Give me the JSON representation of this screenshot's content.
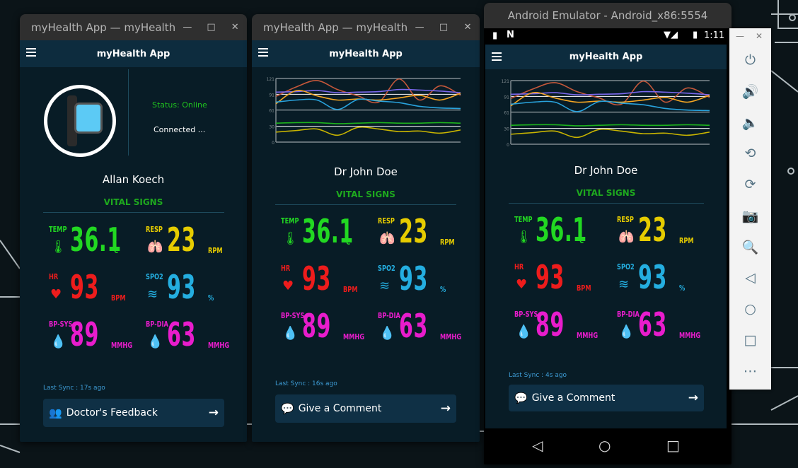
{
  "windows": [
    {
      "title": "myHealth App — myHealth",
      "app_title": "myHealth App",
      "patient_name": "Allan Koech",
      "status": "Status: Online",
      "connection": "Connected ...",
      "section_title": "VITAL SIGNS",
      "last_sync": "Last Sync : 17s ago",
      "button_label": "Doctor's Feedback",
      "button_icon": "users-icon",
      "vitals": [
        {
          "label": "TEMP",
          "value": "36.1",
          "unit": "°C",
          "icon": "thermometer-icon",
          "color": "#22d822"
        },
        {
          "label": "RESP",
          "value": "23",
          "unit": "RPM",
          "icon": "lungs-icon",
          "color": "#e6cc00"
        },
        {
          "label": "HR",
          "value": "93",
          "unit": "BPM",
          "icon": "heartbeat-icon",
          "color": "#ee1c1c"
        },
        {
          "label": "SPO2",
          "value": "93",
          "unit": "%",
          "icon": "wind-icon",
          "color": "#24aee0"
        },
        {
          "label": "BP-SYS",
          "value": "89",
          "unit": "MMHG",
          "icon": "drop-icon",
          "color": "#e81ccc"
        },
        {
          "label": "BP-DIA",
          "value": "63",
          "unit": "MMHG",
          "icon": "drop-icon",
          "color": "#e81ccc"
        }
      ]
    },
    {
      "title": "myHealth App — myHealth",
      "app_title": "myHealth App",
      "patient_name": "Dr John Doe",
      "section_title": "VITAL SIGNS",
      "last_sync": "Last Sync : 16s ago",
      "button_label": "Give a Comment",
      "button_icon": "comment-icon",
      "vitals": [
        {
          "label": "TEMP",
          "value": "36.1",
          "unit": "°C",
          "icon": "thermometer-icon",
          "color": "#22d822"
        },
        {
          "label": "RESP",
          "value": "23",
          "unit": "RPM",
          "icon": "lungs-icon",
          "color": "#e6cc00"
        },
        {
          "label": "HR",
          "value": "93",
          "unit": "BPM",
          "icon": "heartbeat-icon",
          "color": "#ee1c1c"
        },
        {
          "label": "SPO2",
          "value": "93",
          "unit": "%",
          "icon": "wind-icon",
          "color": "#24aee0"
        },
        {
          "label": "BP-SYS",
          "value": "89",
          "unit": "MMHG",
          "icon": "drop-icon",
          "color": "#e81ccc"
        },
        {
          "label": "BP-DIA",
          "value": "63",
          "unit": "MMHG",
          "icon": "drop-icon",
          "color": "#e81ccc"
        }
      ]
    },
    {
      "title": "Android Emulator - Android_x86:5554",
      "app_title": "myHealth App",
      "status_time": "1:11",
      "patient_name": "Dr John Doe",
      "section_title": "VITAL SIGNS",
      "last_sync": "Last Sync : 4s ago",
      "button_label": "Give a Comment",
      "button_icon": "comment-icon",
      "vitals": [
        {
          "label": "TEMP",
          "value": "36.1",
          "unit": "°C",
          "icon": "thermometer-icon",
          "color": "#22d822"
        },
        {
          "label": "RESP",
          "value": "23",
          "unit": "RPM",
          "icon": "lungs-icon",
          "color": "#e6cc00"
        },
        {
          "label": "HR",
          "value": "93",
          "unit": "BPM",
          "icon": "heartbeat-icon",
          "color": "#ee1c1c"
        },
        {
          "label": "SPO2",
          "value": "93",
          "unit": "%",
          "icon": "wind-icon",
          "color": "#24aee0"
        },
        {
          "label": "BP-SYS",
          "value": "89",
          "unit": "MMHG",
          "icon": "drop-icon",
          "color": "#e81ccc"
        },
        {
          "label": "BP-DIA",
          "value": "63",
          "unit": "MMHG",
          "icon": "drop-icon",
          "color": "#e81ccc"
        }
      ]
    }
  ],
  "chart_data": {
    "type": "line",
    "ylim": [
      0,
      121
    ],
    "y_ticks": [
      "121",
      "91",
      "61",
      "30",
      "0"
    ],
    "grid": true,
    "title": "",
    "xlabel": "",
    "ylabel": "",
    "x": [
      1,
      2,
      3,
      4,
      5,
      6,
      7,
      8,
      9,
      10
    ],
    "series": [
      {
        "color": "#c4573a",
        "values": [
          87,
          105,
          117,
          100,
          88,
          76,
          120,
          80,
          107,
          89
        ]
      },
      {
        "color": "#7b68ee",
        "values": [
          95,
          96,
          98,
          94,
          95,
          96,
          100,
          99,
          97,
          94
        ]
      },
      {
        "color": "#f5a623",
        "values": [
          73,
          98,
          88,
          80,
          82,
          80,
          84,
          89,
          80,
          93
        ]
      },
      {
        "color": "#29a3dd",
        "values": [
          76,
          80,
          80,
          62,
          81,
          78,
          75,
          68,
          65,
          64
        ]
      },
      {
        "color": "#1db31d",
        "values": [
          36,
          37,
          37,
          35,
          36,
          37,
          36,
          36,
          37,
          36
        ]
      },
      {
        "color": "#c8b400",
        "values": [
          19,
          22,
          25,
          13,
          28,
          25,
          20,
          21,
          17,
          23
        ]
      }
    ]
  },
  "emulator_toolbar": [
    "power-icon",
    "volume-up-icon",
    "volume-down-icon",
    "rotate-left-icon",
    "rotate-right-icon",
    "camera-icon",
    "zoom-icon",
    "back-icon",
    "home-icon",
    "overview-icon",
    "more-icon"
  ]
}
